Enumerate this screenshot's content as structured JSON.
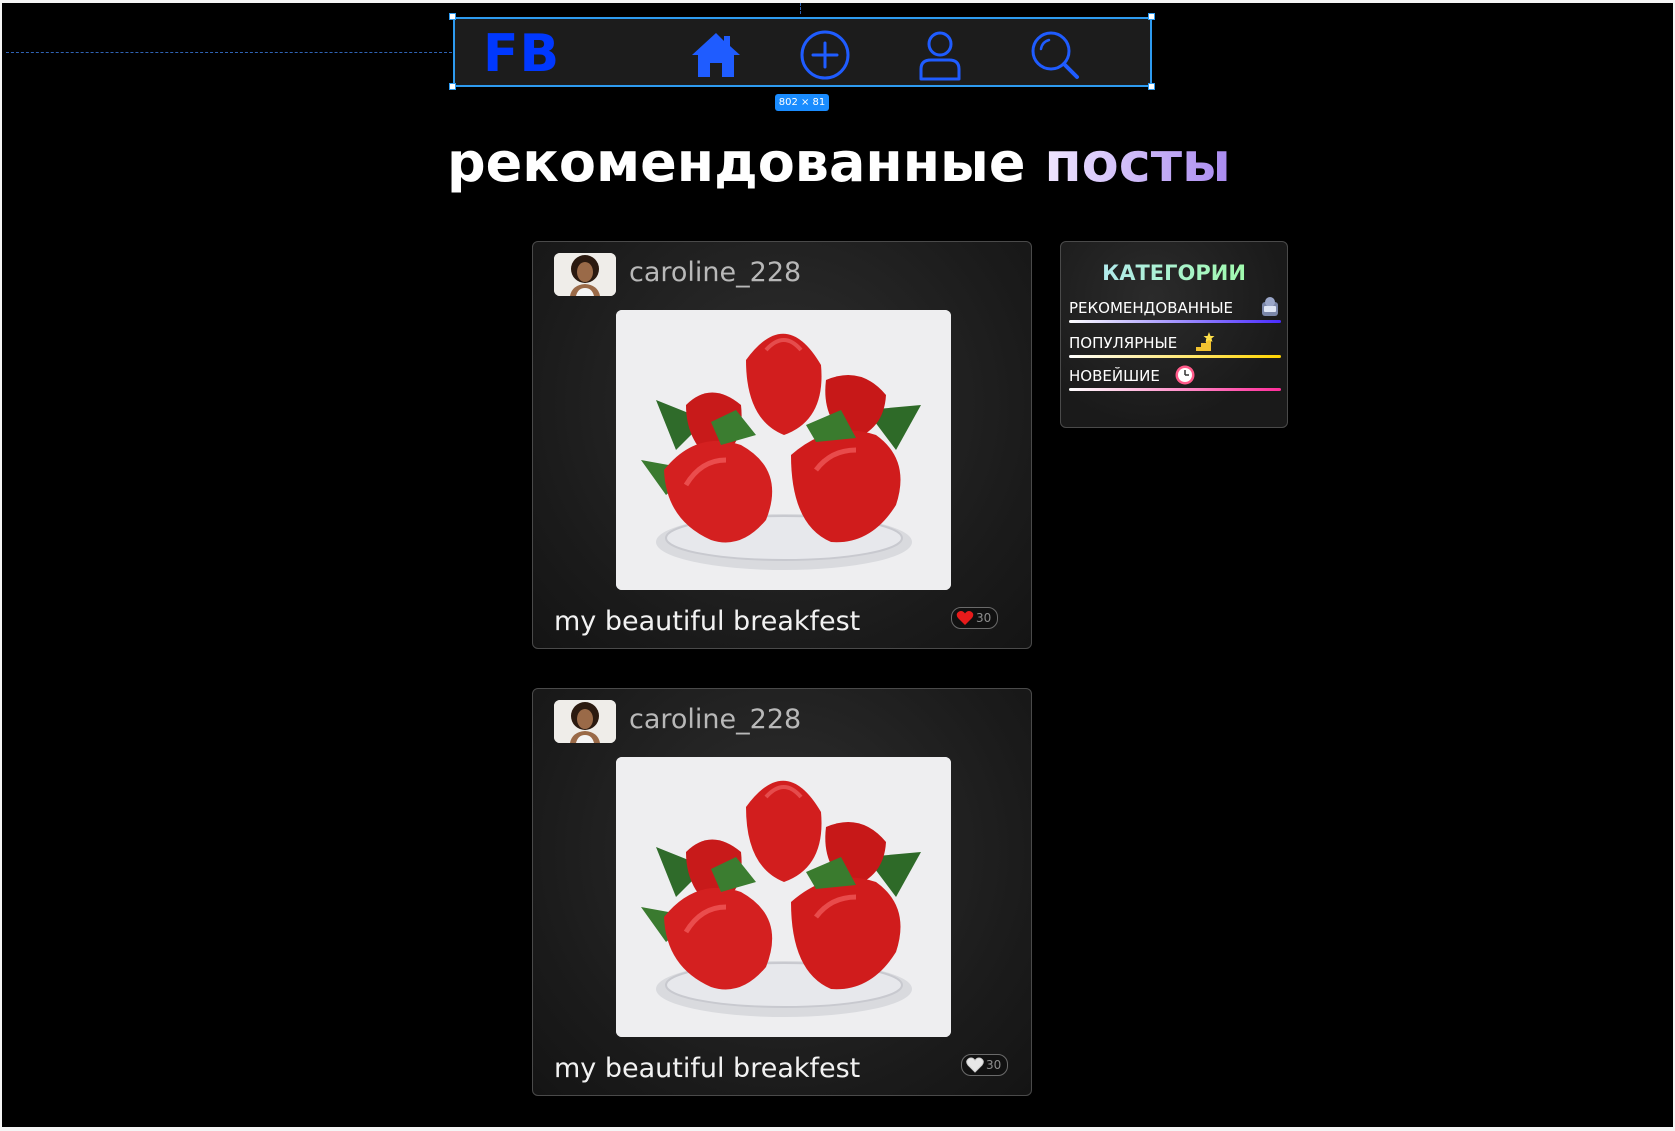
{
  "editor": {
    "selection_size": "802 × 81",
    "selection_color": "#2e9bf0"
  },
  "navbar": {
    "logo": "FB",
    "logo_color": "#0038ff",
    "icon_color": "#1f5cff",
    "icons": [
      "home-icon",
      "add-circle-icon",
      "user-icon",
      "search-icon"
    ]
  },
  "heading": {
    "part1": "рекомендованные",
    "part2": "посты"
  },
  "posts": [
    {
      "author": "caroline_228",
      "caption": "my beautiful breakfest",
      "likes": "30",
      "liked": true
    },
    {
      "author": "caroline_228",
      "caption": "my beautiful breakfest",
      "likes": "30",
      "liked": false
    }
  ],
  "categories": {
    "title": "КАТЕГОРИИ",
    "items": [
      {
        "label": "РЕКОМЕНДОВАННЫЕ",
        "emoji": "for-you-icon",
        "underline": [
          "#ffffff",
          "#4a2cff"
        ]
      },
      {
        "label": "ПОПУЛЯРНЫЕ",
        "emoji": "stairs-star-icon",
        "underline": [
          "#ffffff",
          "#ffd400"
        ]
      },
      {
        "label": "НОВЕЙШИЕ",
        "emoji": "clock-icon",
        "underline": [
          "#ffffff",
          "#ff2d9a"
        ]
      }
    ]
  }
}
